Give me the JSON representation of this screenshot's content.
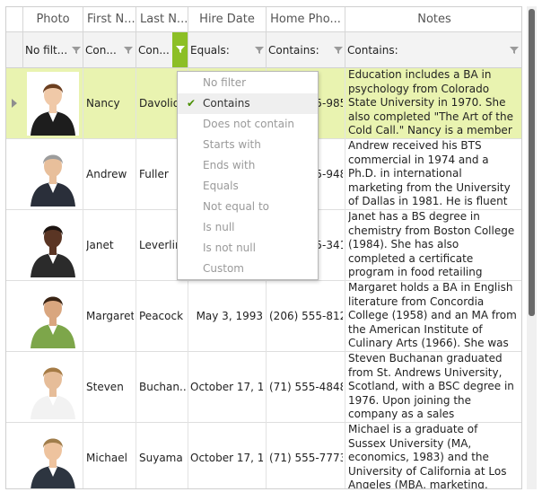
{
  "columns": {
    "photo": "Photo",
    "first_name": "First N...",
    "last_name": "Last N...",
    "hire_date": "Hire Date",
    "home_phone": "Home Pho...",
    "notes": "Notes"
  },
  "filters": {
    "photo": "No filt...",
    "first_name": "Con...",
    "last_name": "Con...",
    "hire_date": "Equals:",
    "home_phone": "Contains:",
    "notes": "Contains:"
  },
  "filter_menu": {
    "items": [
      "No filter",
      "Contains",
      "Does not contain",
      "Starts with",
      "Ends with",
      "Equals",
      "Not equal to",
      "Is null",
      "Is not null",
      "Custom"
    ],
    "checked": "Contains"
  },
  "rows": [
    {
      "first_name": "Nancy",
      "last_name": "Davolio",
      "hire_date": "",
      "home_phone": "(206) 555-9857",
      "notes": "Education includes a BA in psychology from Colorado State University in 1970.  She also completed \"The Art of the Cold Call.\"  Nancy is a member of Toas...",
      "selected": true
    },
    {
      "first_name": "Andrew",
      "last_name": "Fuller",
      "hire_date": "",
      "home_phone": "(206) 555-9482",
      "notes": "Andrew received his BTS commercial in 1974 and a Ph.D. in international marketing from the University of Dallas in 1981.  He is fluent in French and Italian and r...",
      "selected": false
    },
    {
      "first_name": "Janet",
      "last_name": "Leverling",
      "hire_date": "",
      "home_phone": "(206) 555-3412",
      "notes": "Janet has a BS degree in chemistry from Boston College (1984).  She has also completed a certificate program in food retailing management.  Janet was hired as...",
      "selected": false
    },
    {
      "first_name": "Margaret",
      "last_name": "Peacock",
      "hire_date": "May 3, 1993",
      "home_phone": "(206) 555-8122",
      "notes": "Margaret holds a BA in English literature from Concordia College (1958) and an MA from the American Institute of Culinary Arts (1966).  She was assigned to the...",
      "selected": false
    },
    {
      "first_name": "Steven",
      "last_name": "Buchan...",
      "hire_date": "October 17, 1...",
      "home_phone": "(71) 555-4848",
      "notes": "Steven Buchanan graduated from St. Andrews University, Scotland, with a BSC degree in 1976.  Upon joining the company as a sales representative in 1992, he spent...",
      "selected": false
    },
    {
      "first_name": "Michael",
      "last_name": "Suyama",
      "hire_date": "October 17, 1...",
      "home_phone": "(71) 555-7773",
      "notes": "Michael is a graduate of Sussex University (MA, economics, 1983) and the University of California at Los Angeles (MBA, marketing, 1986).  He has also taken the cou...",
      "selected": false
    }
  ],
  "colors": {
    "accent": "#8cbf26",
    "selected_row": "#e9f3b0"
  }
}
